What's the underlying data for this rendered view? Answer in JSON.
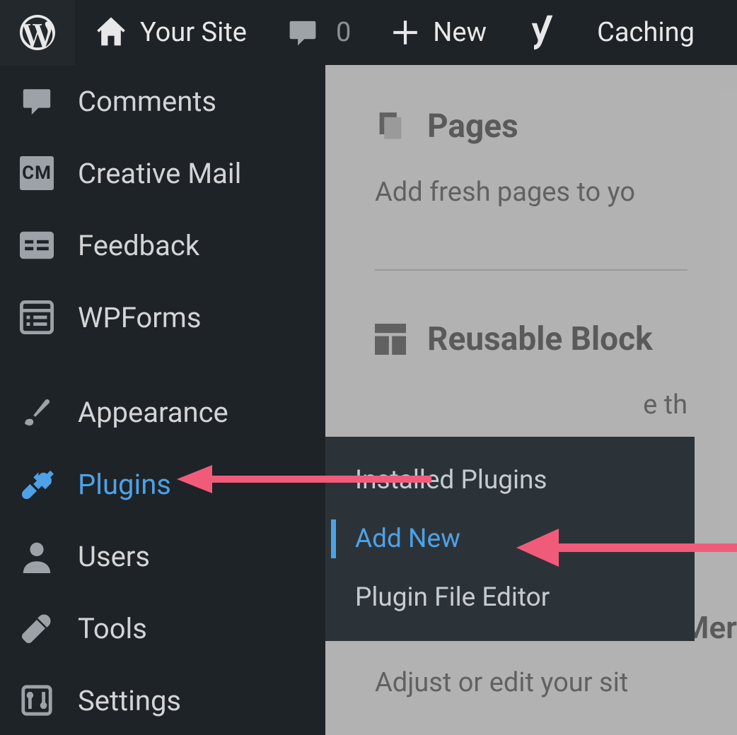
{
  "adminbar": {
    "site_name": "Your Site",
    "comments_count": "0",
    "new_label": "New",
    "caching_label": "Caching"
  },
  "sidebar": {
    "comments": "Comments",
    "creative_mail": "Creative Mail",
    "feedback": "Feedback",
    "wpforms": "WPForms",
    "appearance": "Appearance",
    "plugins": "Plugins",
    "users": "Users",
    "tools": "Tools",
    "settings": "Settings"
  },
  "submenu": {
    "installed": "Installed Plugins",
    "add_new": "Add New",
    "editor": "Plugin File Editor"
  },
  "content": {
    "pages_heading": "Pages",
    "pages_text": "Add fresh pages to yo",
    "reusable_heading": "Reusable Block",
    "reusable_text_partial": "e th",
    "menu_partial": "Mer",
    "bottom_text": "Adjust or edit your sit"
  }
}
